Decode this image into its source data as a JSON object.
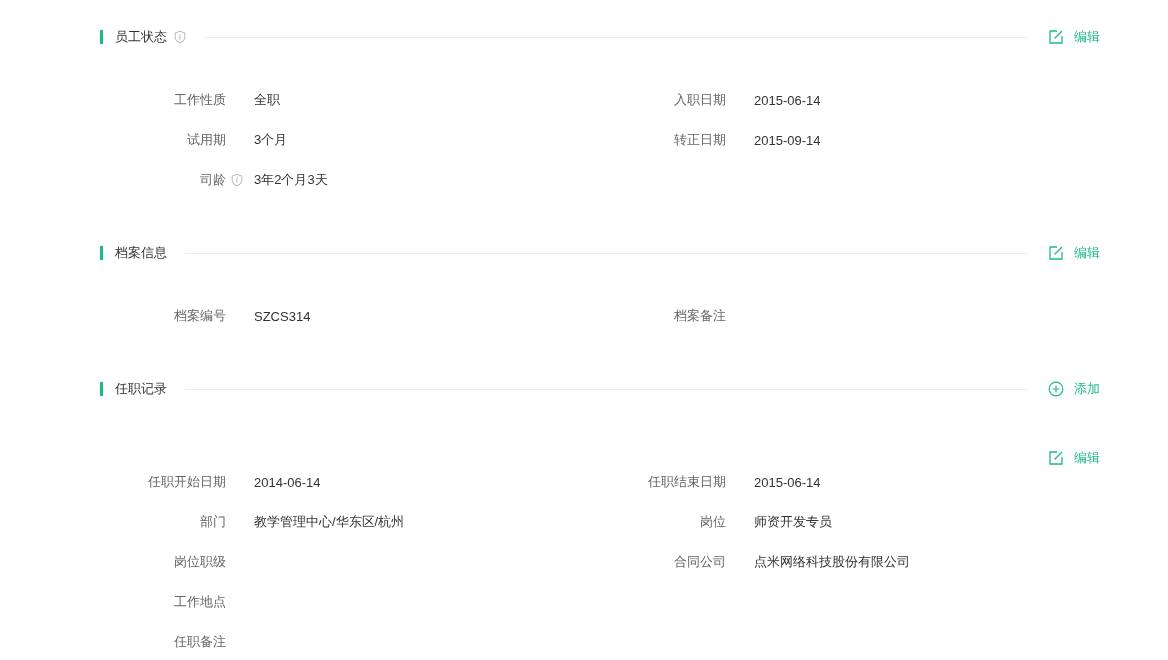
{
  "sections": [
    {
      "title": "员工状态",
      "shield": true,
      "action": {
        "kind": "edit",
        "label": "编辑"
      },
      "blocks": [
        {
          "rows": [
            [
              {
                "label": "工作性质",
                "value": "全职",
                "shield": false
              },
              {
                "label": "入职日期",
                "value": "2015-06-14",
                "shield": false
              }
            ],
            [
              {
                "label": "试用期",
                "value": "3个月",
                "shield": false
              },
              {
                "label": "转正日期",
                "value": "2015-09-14",
                "shield": false
              }
            ],
            [
              {
                "label": "司龄",
                "value": "3年2个月3天",
                "shield": true
              }
            ]
          ]
        }
      ]
    },
    {
      "title": "档案信息",
      "shield": false,
      "action": {
        "kind": "edit",
        "label": "编辑"
      },
      "blocks": [
        {
          "rows": [
            [
              {
                "label": "档案编号",
                "value": "SZCS314",
                "shield": false
              },
              {
                "label": "档案备注",
                "shield": false
              }
            ]
          ]
        }
      ]
    },
    {
      "title": "任职记录",
      "shield": false,
      "action": {
        "kind": "add",
        "label": "添加"
      },
      "blocks": [
        {
          "action": {
            "kind": "edit",
            "label": "编辑"
          },
          "rows": [
            [
              {
                "label": "任职开始日期",
                "value": "2014-06-14",
                "shield": false
              },
              {
                "label": "任职结束日期",
                "value": "2015-06-14",
                "shield": false
              }
            ],
            [
              {
                "label": "部门",
                "value": "教学管理中心/华东区/杭州",
                "shield": false
              },
              {
                "label": "岗位",
                "value": "师资开发专员",
                "shield": false
              }
            ],
            [
              {
                "label": "岗位职级",
                "shield": false
              },
              {
                "label": "合同公司",
                "value": "点米网络科技股份有限公司",
                "shield": false
              }
            ],
            [
              {
                "label": "工作地点",
                "shield": false
              }
            ],
            [
              {
                "label": "任职备注",
                "shield": false
              }
            ]
          ]
        }
      ]
    }
  ]
}
